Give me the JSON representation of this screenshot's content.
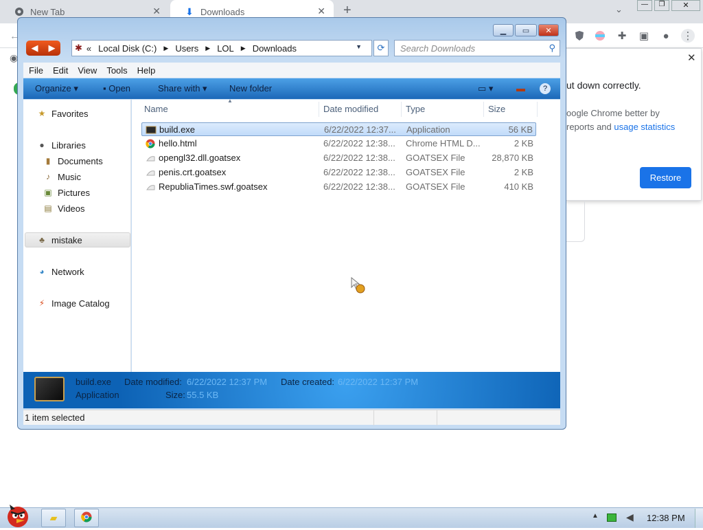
{
  "browser": {
    "tabs": [
      {
        "label": "New Tab",
        "icon": "chrome-icon"
      },
      {
        "label": "Downloads",
        "icon": "download-icon"
      }
    ],
    "restore_popup": {
      "line1": "ut down correctly.",
      "line2": "oogle Chrome better by",
      "line3a": "reports and ",
      "line3b": "usage statistics",
      "restore_label": "Restore"
    }
  },
  "explorer": {
    "breadcrumb": {
      "prefix": "«",
      "parts": [
        "Local Disk (C:)",
        "Users",
        "LOL",
        "Downloads"
      ]
    },
    "search_placeholder": "Search Downloads",
    "menu": [
      "File",
      "Edit",
      "View",
      "Tools",
      "Help"
    ],
    "commands": {
      "organize": "Organize",
      "open": "Open",
      "share_with": "Share with",
      "new_folder": "New folder"
    },
    "nav": {
      "favorites": "Favorites",
      "libraries": "Libraries",
      "documents": "Documents",
      "music": "Music",
      "pictures": "Pictures",
      "videos": "Videos",
      "mistake": "mistake",
      "network": "Network",
      "image_catalog": "Image Catalog"
    },
    "columns": {
      "name": "Name",
      "date": "Date modified",
      "type": "Type",
      "size": "Size"
    },
    "files": [
      {
        "name": "build.exe",
        "date": "6/22/2022 12:37...",
        "type": "Application",
        "size": "56 KB",
        "icon": "exe-icon"
      },
      {
        "name": "hello.html",
        "date": "6/22/2022 12:38...",
        "type": "Chrome HTML D...",
        "size": "2 KB",
        "icon": "chrome-icon"
      },
      {
        "name": "opengl32.dll.goatsex",
        "date": "6/22/2022 12:38...",
        "type": "GOATSEX File",
        "size": "28,870 KB",
        "icon": "file-icon"
      },
      {
        "name": "penis.crt.goatsex",
        "date": "6/22/2022 12:38...",
        "type": "GOATSEX File",
        "size": "2 KB",
        "icon": "file-icon"
      },
      {
        "name": "RepubliaTimes.swf.goatsex",
        "date": "6/22/2022 12:38...",
        "type": "GOATSEX File",
        "size": "410 KB",
        "icon": "file-icon"
      }
    ],
    "details": {
      "name": "build.exe",
      "kind": "Application",
      "date_modified_label": "Date modified:",
      "date_modified": "6/22/2022 12:37 PM",
      "date_created_label": "Date created:",
      "date_created": "6/22/2022 12:37 PM",
      "size_label": "Size:",
      "size": "55.5 KB"
    },
    "status": "1 item selected"
  },
  "taskbar": {
    "clock": "12:38 PM"
  }
}
